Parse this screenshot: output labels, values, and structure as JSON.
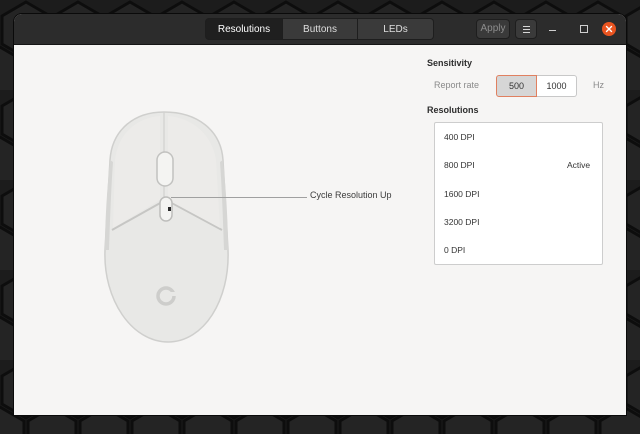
{
  "header": {
    "tabs": [
      {
        "label": "Resolutions",
        "active": true
      },
      {
        "label": "Buttons",
        "active": false
      },
      {
        "label": "LEDs",
        "active": false
      }
    ],
    "apply_label": "Apply",
    "menu_icon": "hamburger-icon",
    "window_controls": [
      "minimize-icon",
      "maximize-icon",
      "close-icon"
    ]
  },
  "device": {
    "callout_label": "Cycle Resolution Up"
  },
  "sensitivity": {
    "title": "Sensitivity",
    "report_rate_label": "Report rate",
    "rates": [
      "500",
      "1000"
    ],
    "selected_rate": "500",
    "unit": "Hz"
  },
  "resolutions": {
    "title": "Resolutions",
    "items": [
      {
        "label": "400 DPI",
        "status": ""
      },
      {
        "label": "800 DPI",
        "status": "Active"
      },
      {
        "label": "1600 DPI",
        "status": ""
      },
      {
        "label": "3200 DPI",
        "status": ""
      },
      {
        "label": "0 DPI",
        "status": ""
      }
    ]
  },
  "colors": {
    "accent_close": "#e95420",
    "headerbar": "#2c2c2c",
    "window_bg": "#f6f5f4",
    "mouse_body": "#e8e8e6"
  }
}
